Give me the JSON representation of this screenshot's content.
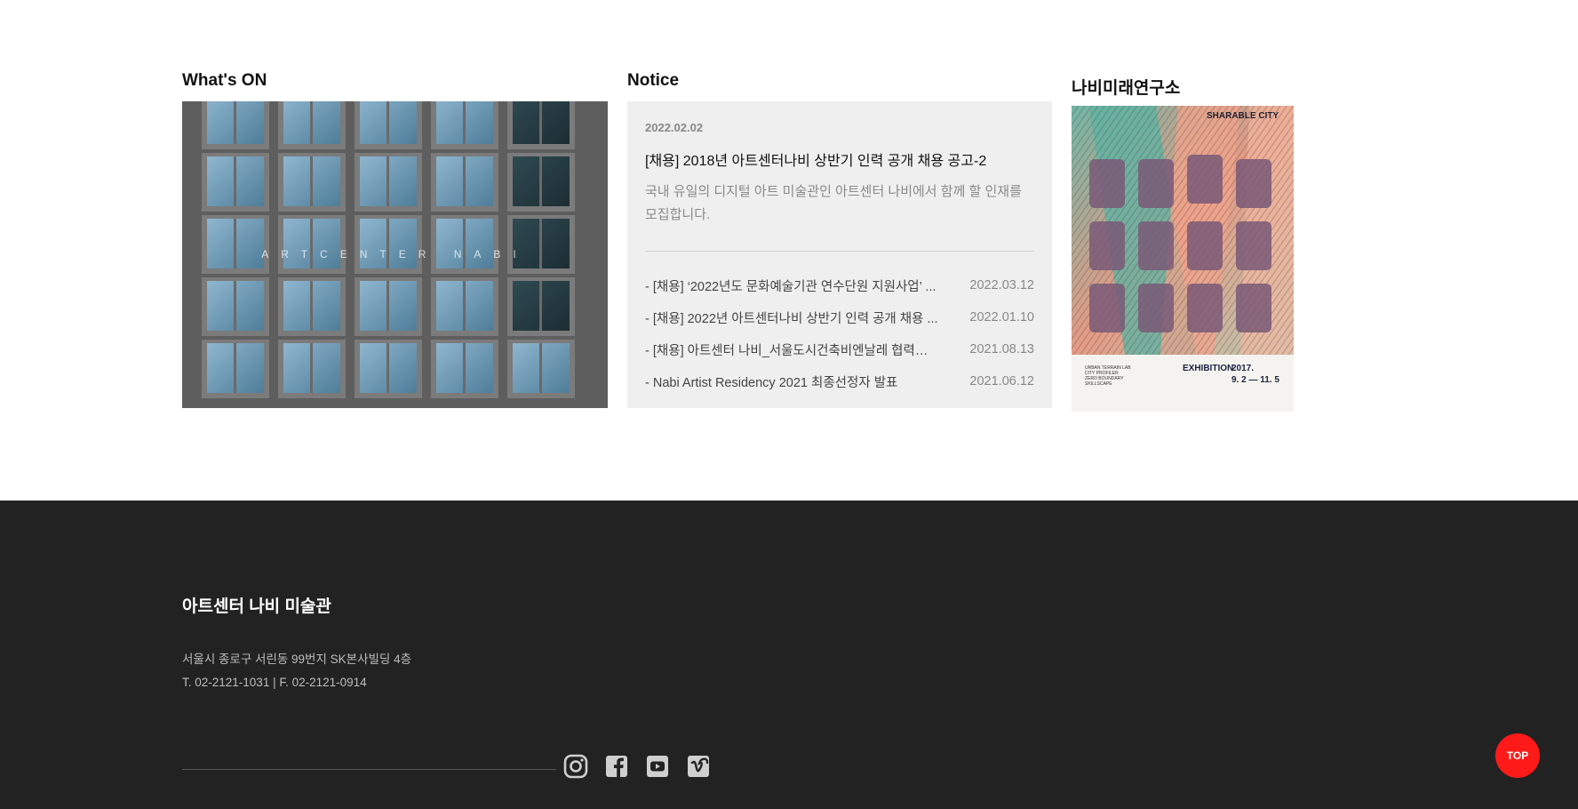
{
  "whatson": {
    "title": "What's ON",
    "image_caption": "ARTCENTER NABI"
  },
  "notice": {
    "title": "Notice",
    "featured": {
      "date": "2022.02.02",
      "headline": "[채용] 2018년 아트센터나비 상반기 인력 공개 채용 공고-2",
      "summary": "국내 유일의 디지털 아트 미술관인 아트센터 나비에서 함께 할 인재를 모집합니다."
    },
    "items": [
      {
        "title": "- [채용] ‘2022년도 문화예술기관 연수단원 지원사업’ ...",
        "date": "2022.03.12"
      },
      {
        "title": "- [채용] 2022년 아트센터나비 상반기 인력 공개 채용 ...",
        "date": "2022.01.10"
      },
      {
        "title": "- [채용] 아트센터 나비_서울도시건축비엔날레 협력전 ...",
        "date": "2021.08.13"
      },
      {
        "title": "- Nabi Artist Residency 2021 최종선정자 발표",
        "date": "2021.06.12"
      }
    ]
  },
  "lab": {
    "title": "나비미래연구소",
    "poster": {
      "head": "SHARABLE CITY",
      "exhibition": "EXHIBITION",
      "year": "2017.",
      "dates": "9. 2 — 11. 5"
    }
  },
  "footer": {
    "title": "아트센터 나비 미술관",
    "address": "서울시 종로구 서린동 99번지 SK본사빌딩 4층",
    "contact": "T. 02-2121-1031  |  F. 02-2121-0914",
    "social": [
      "instagram-icon",
      "facebook-icon",
      "youtube-icon",
      "vimeo-icon"
    ]
  },
  "top_button": "TOP",
  "colors": {
    "footer_bg": "#222222",
    "top_button": "#ff1a1a",
    "notice_bg": "#efefef"
  }
}
